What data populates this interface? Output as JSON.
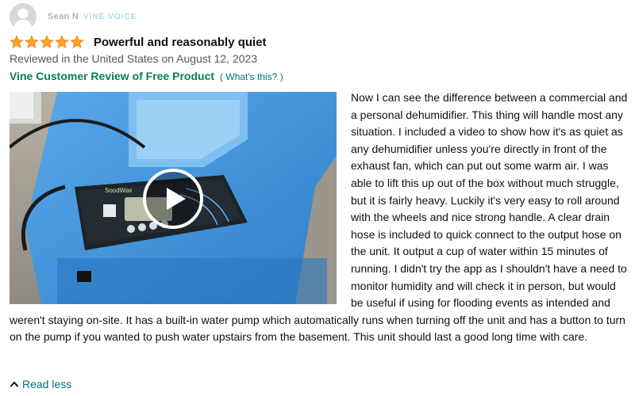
{
  "reviewer": {
    "name": "Sean N",
    "badge": "VINE VOICE",
    "avatar_icon": "user-silhouette-icon"
  },
  "review": {
    "rating": 5,
    "stars_max": 5,
    "star_color": "#ffa41c",
    "title": "Powerful and reasonably quiet",
    "date": "Reviewed in the United States on August 12, 2023",
    "vine_label": "Vine Customer Review of Free Product",
    "whats_this": "What's this?",
    "body": " Now I can see the difference between a commercial and a personal dehumidifier. This thing will handle most any situation. I included a video to show how it's as quiet as any dehumidifier unless you're directly in front of the exhaust fan, which can put out some warm air. I was able to lift this up out of the box without much struggle, but it is fairly heavy. Luckily it's very easy to roll around with the wheels and nice strong handle. A clear drain hose is included to quick connect to the output hose on the unit. It output a cup of water within 15 minutes of running. I didn't try the app as I shouldn't have a need to monitor humidity and will check it in person, but would be useful if using for flooding events as intended and weren't staying on-site. It has a built-in water pump which automatically runs when turning off the unit and has a button to turn on the pump if you wanted to push water upstairs from the basement. This unit should last a good long time with care.",
    "read_less": "Read less"
  },
  "video": {
    "play_icon": "play-icon",
    "device_brand": "SoodWax",
    "device_color": "#3d8fd6"
  },
  "colors": {
    "link": "#007185",
    "vine_green": "#067d62",
    "text": "#0f1111",
    "muted": "#565959"
  }
}
